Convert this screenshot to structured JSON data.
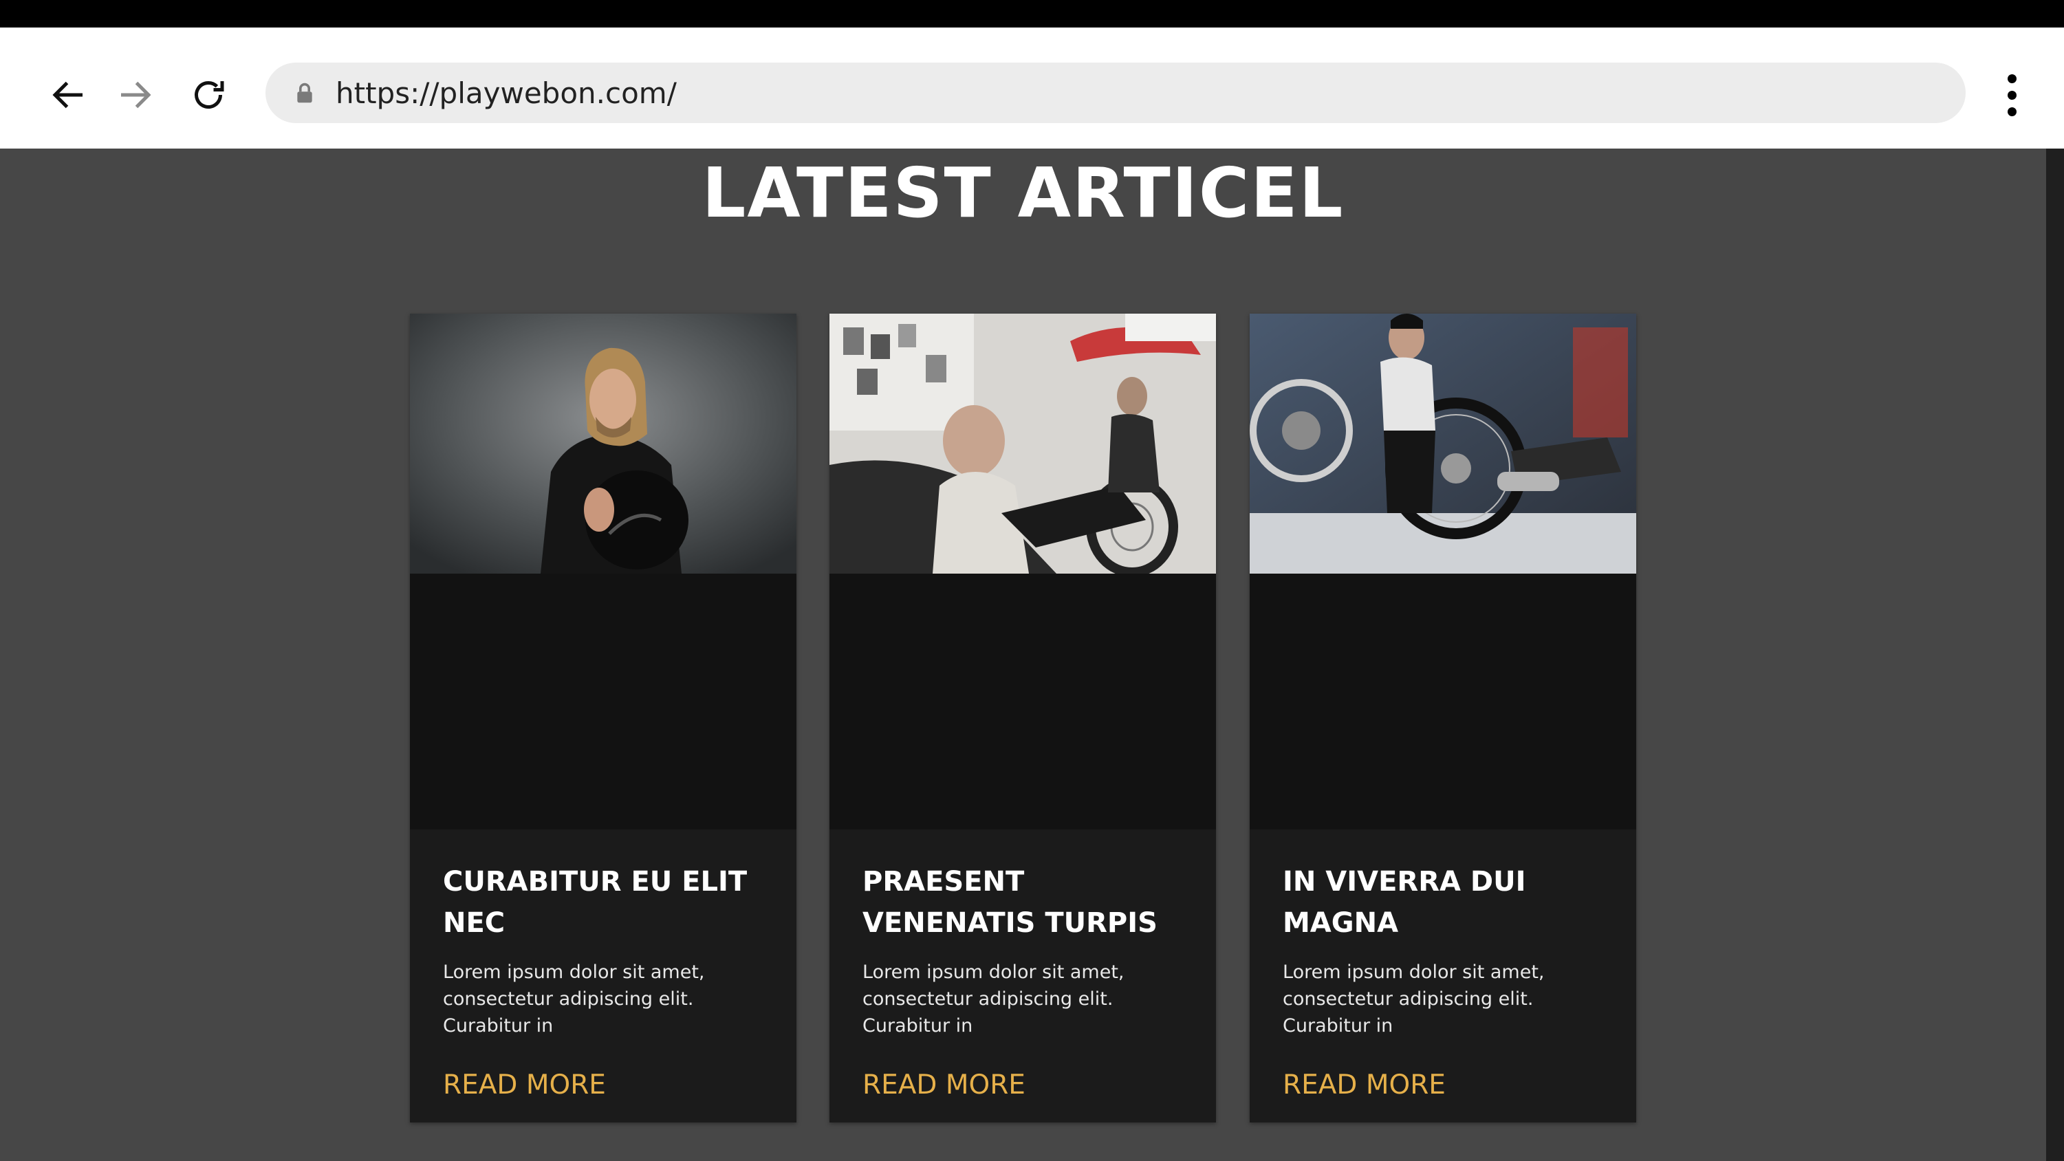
{
  "browser": {
    "url": "https://playwebon.com/"
  },
  "section": {
    "title": "LATEST ARTICEL"
  },
  "articles": [
    {
      "title": "CURABITUR EU ELIT NEC",
      "excerpt": "Lorem ipsum dolor sit amet, consectetur adipiscing elit. Curabitur in",
      "link": "READ MORE",
      "image": "man-holding-helmet"
    },
    {
      "title": "PRAESENT VENENATIS TURPIS",
      "excerpt": "Lorem ipsum dolor sit amet, consectetur adipiscing elit. Curabitur in",
      "link": "READ MORE",
      "image": "mechanics-in-workshop"
    },
    {
      "title": "IN VIVERRA DUI MAGNA",
      "excerpt": "Lorem ipsum dolor sit amet, consectetur adipiscing elit. Curabitur in",
      "link": "READ MORE",
      "image": "mechanic-repairing-motorcycle"
    }
  ],
  "colors": {
    "page_background": "#474747",
    "card_background": "#1b1b1b",
    "link_accent": "#e6b04a"
  }
}
